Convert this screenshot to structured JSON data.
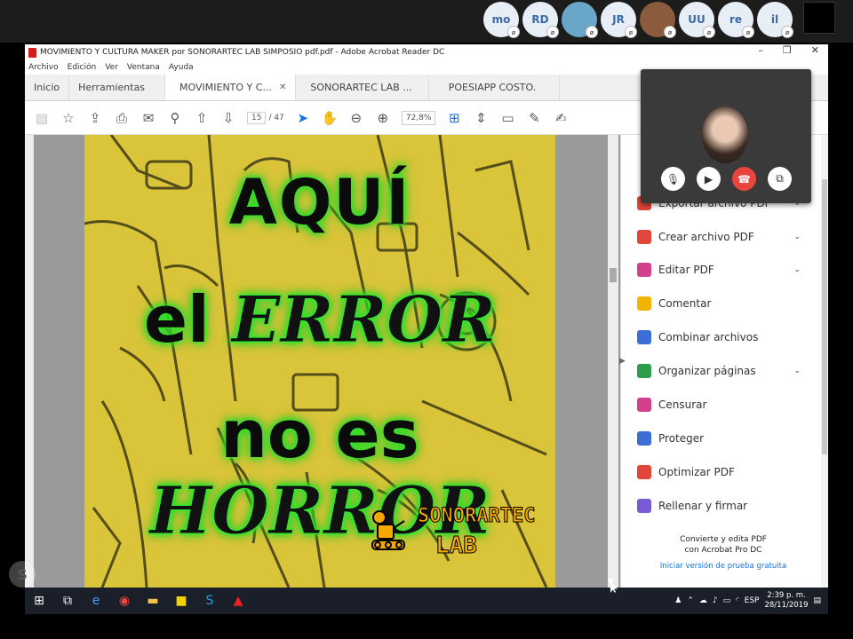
{
  "call": {
    "participants": [
      {
        "initials": "mo"
      },
      {
        "initials": "RD"
      },
      {
        "initials": ""
      },
      {
        "initials": "JR"
      },
      {
        "initials": ""
      },
      {
        "initials": "UU"
      },
      {
        "initials": "re"
      },
      {
        "initials": "il"
      }
    ]
  },
  "window": {
    "title": "MOVIMIENTO Y CULTURA MAKER por SONORARTEC LAB SIMPOSIO pdf.pdf - Adobe Acrobat Reader DC",
    "menu": [
      "Archivo",
      "Edición",
      "Ver",
      "Ventana",
      "Ayuda"
    ],
    "tabs": [
      {
        "label": "Inicio"
      },
      {
        "label": "Herramientas"
      },
      {
        "label": "MOVIMIENTO Y C..."
      },
      {
        "label": "SONORARTEC LAB ..."
      },
      {
        "label": "POESIAPP COSTO."
      }
    ]
  },
  "toolbar": {
    "page_current": "15",
    "page_total": "/ 47",
    "zoom": "72,8%"
  },
  "poster": {
    "line1": "AQUÍ",
    "line2_a": "el ",
    "line2_b": "ERROR",
    "line3_a": "no es ",
    "line3_b": "HORROR",
    "logo_top": "SONORARTEC",
    "logo_bottom": "LAB"
  },
  "tools": [
    {
      "label": "Exportar archivo PDF",
      "color": "#e0463a"
    },
    {
      "label": "Crear archivo PDF",
      "color": "#e0463a"
    },
    {
      "label": "Editar PDF",
      "color": "#d1408b"
    },
    {
      "label": "Comentar",
      "color": "#f2b400"
    },
    {
      "label": "Combinar archivos",
      "color": "#3c6fd6"
    },
    {
      "label": "Organizar páginas",
      "color": "#2e9d4a"
    },
    {
      "label": "Censurar",
      "color": "#d1408b"
    },
    {
      "label": "Proteger",
      "color": "#3c6fd6"
    },
    {
      "label": "Optimizar PDF",
      "color": "#e0463a"
    },
    {
      "label": "Rellenar y firmar",
      "color": "#7a5bd6"
    }
  ],
  "promo": {
    "line1": "Convierte y edita PDF",
    "line2": "con Acrobat Pro DC",
    "link": "Iniciar versión de prueba gratuita"
  },
  "tray": {
    "lang": "ESP",
    "time": "2:39 p. m.",
    "date": "28/11/2019"
  }
}
